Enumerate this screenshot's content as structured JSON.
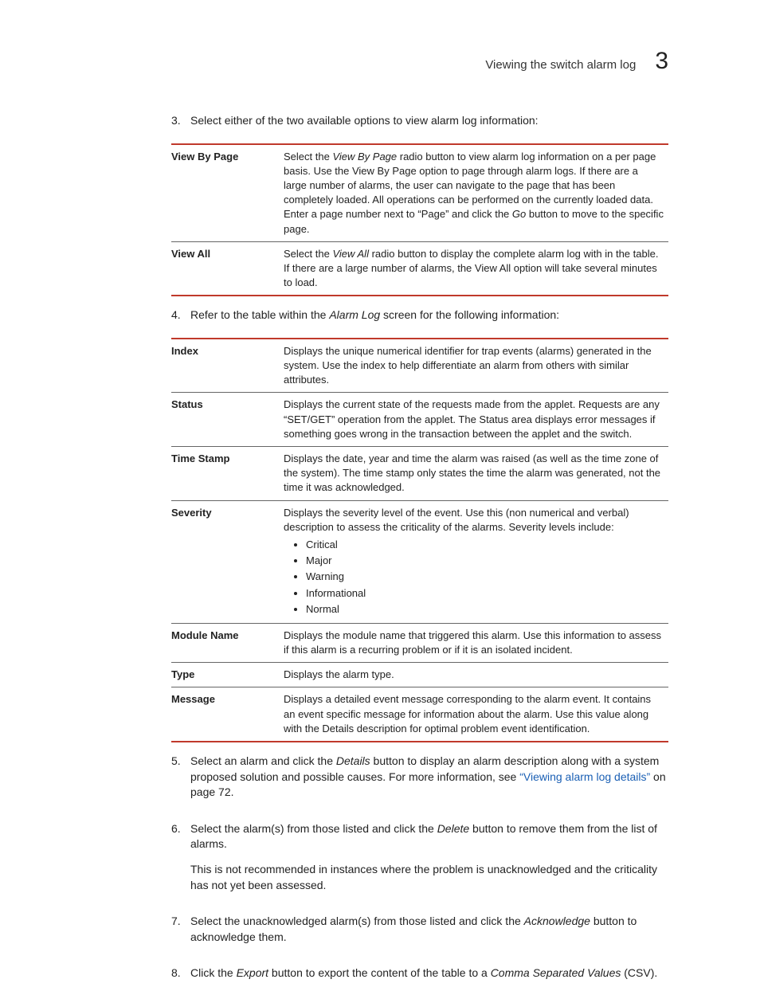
{
  "header": {
    "running_title": "Viewing the switch alarm log",
    "chapter_number": "3"
  },
  "steps": {
    "s3": {
      "num": "3.",
      "text": "Select either of the two available options to view alarm log information:"
    },
    "table1": {
      "r0": {
        "term": "View By Page",
        "desc_a": "Select the ",
        "desc_b": "View By Page",
        "desc_c": " radio button to view alarm log information on a per page basis. Use the View By Page option to page through alarm logs. If there are a large number of alarms, the user can navigate to the page that has been completely loaded. All operations can be performed on the currently loaded data. Enter a page number next to “Page” and click the ",
        "desc_d": "Go",
        "desc_e": " button to move to the specific page."
      },
      "r1": {
        "term": "View All",
        "desc_a": "Select the ",
        "desc_b": "View All",
        "desc_c": " radio button to display the complete alarm log with in the table. If there are a large number of alarms, the View All option will take several minutes to load."
      }
    },
    "s4": {
      "num": "4.",
      "text_a": "Refer to the table within the ",
      "text_b": "Alarm Log",
      "text_c": " screen for the following information:"
    },
    "table2": {
      "r0": {
        "term": "Index",
        "desc": "Displays the unique numerical identifier for trap events (alarms) generated in the system. Use the index to help differentiate an alarm from others with similar attributes."
      },
      "r1": {
        "term": "Status",
        "desc": "Displays the current state of the requests made from the applet. Requests are any “SET/GET” operation from the applet. The Status area displays error messages if something goes wrong in the transaction between the applet and the switch."
      },
      "r2": {
        "term": "Time Stamp",
        "desc": "Displays the date, year and time the alarm was raised (as well as the time zone of the system). The time stamp only states the time the alarm was generated, not the time it was acknowledged."
      },
      "r3": {
        "term": "Severity",
        "desc": "Displays the severity level of the event. Use this (non numerical and verbal) description to assess the criticality of the alarms. Severity levels include:",
        "items": [
          "Critical",
          "Major",
          "Warning",
          "Informational",
          "Normal"
        ]
      },
      "r4": {
        "term": "Module Name",
        "desc": "Displays the module name that triggered this alarm. Use this information to assess if this alarm is a recurring problem or if it is an isolated incident."
      },
      "r5": {
        "term": "Type",
        "desc": "Displays the alarm type."
      },
      "r6": {
        "term": "Message",
        "desc": "Displays a detailed event message corresponding to the alarm event. It contains an event specific message for information about the alarm. Use this value along with the Details description for optimal problem event identification."
      }
    },
    "s5": {
      "num": "5.",
      "text_a": "Select an alarm and click the ",
      "text_b": "Details",
      "text_c": " button to display an alarm description along with a system proposed solution and possible causes. For more information, see ",
      "link": "“Viewing alarm log details”",
      "text_d": " on page 72."
    },
    "s6": {
      "num": "6.",
      "text_a": "Select the alarm(s) from those listed and click the ",
      "text_b": "Delete",
      "text_c": " button to remove them from the list of alarms.",
      "para2": "This is not recommended in instances where the problem is unacknowledged and the criticality has not yet been assessed."
    },
    "s7": {
      "num": "7.",
      "text_a": "Select the unacknowledged alarm(s) from those listed and click the ",
      "text_b": "Acknowledge",
      "text_c": " button to acknowledge them."
    },
    "s8": {
      "num": "8.",
      "text_a": "Click the ",
      "text_b": "Export",
      "text_c": " button to export the content of the table to a ",
      "text_d": "Comma Separated Values",
      "text_e": " (CSV)."
    }
  }
}
